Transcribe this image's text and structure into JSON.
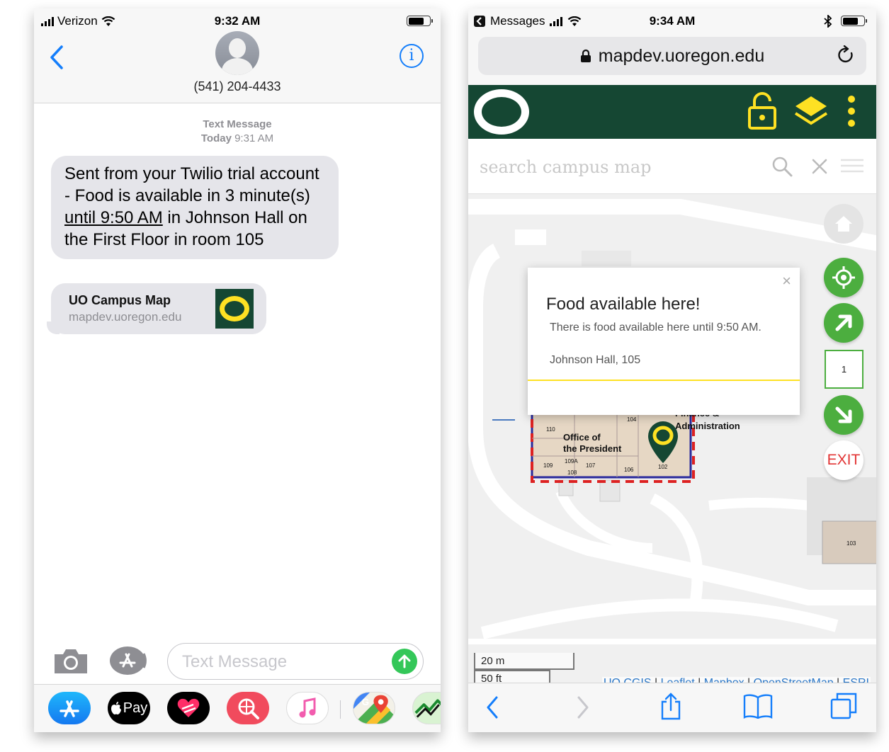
{
  "left_phone": {
    "status": {
      "carrier": "Verizon",
      "time": "9:32 AM"
    },
    "contact": {
      "phone": "(541) 204-4433"
    },
    "thread": {
      "meta_label": "Text Message",
      "meta_day": "Today",
      "meta_time": "9:31 AM",
      "message_part1": "Sent from your Twilio trial account - Food is available in 3 minute(s) ",
      "message_link": "until 9:50 AM",
      "message_part2": " in Johnson Hall on the First Floor in room 105",
      "link_preview": {
        "title": "UO Campus Map",
        "url": "mapdev.uoregon.edu"
      }
    },
    "compose": {
      "placeholder": "Text Message"
    },
    "app_drawer": {
      "applepay_label": "Pay"
    }
  },
  "right_phone": {
    "status": {
      "back_app": "Messages",
      "time": "9:34 AM"
    },
    "url": "mapdev.uoregon.edu",
    "search_placeholder": "search campus map",
    "floor": "1",
    "exit_label": "EXIT",
    "popup": {
      "close": "×",
      "title": "Food available here!",
      "description": "There is food available here until 9:50 AM.",
      "location": "Johnson Hall, 105"
    },
    "map_labels": {
      "office_line1": "Office of",
      "office_line2": "the President",
      "finance_line1": "Finance &",
      "finance_line2": "Administration",
      "rooms": [
        "110",
        "104",
        "109",
        "109A",
        "107",
        "106",
        "108",
        "102",
        "103"
      ]
    },
    "scale": {
      "metric": "20 m",
      "imperial": "50 ft"
    },
    "attribution": [
      "UO CGIS",
      "Leaflet",
      "Mapbox",
      "OpenStreetMap",
      "ESRI"
    ]
  },
  "colors": {
    "uo_green": "#154733",
    "uo_yellow": "#fee123",
    "ios_blue": "#147efb",
    "bubble_gray": "#e5e5ea",
    "map_button_green": "#4cae3f",
    "exit_red": "#e23434"
  }
}
